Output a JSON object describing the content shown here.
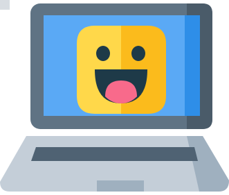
{
  "illustration": {
    "subject": "laptop-emoji-icon",
    "colors": {
      "bezel_dark": "#4a5b69",
      "bezel_mid": "#5f7384",
      "screen_blue": "#5aa9f5",
      "screen_blue_dark": "#2e8ee8",
      "base_light": "#c4ced8",
      "base_dark": "#9fb0bf",
      "keyboard_slot": "#4f6273",
      "trackpad": "#b9c5cf",
      "emoji_yellow_light": "#ffd84a",
      "emoji_yellow_dark": "#fbbb1c",
      "emoji_eye": "#1e3a48",
      "emoji_mouth": "#1e3a48",
      "emoji_tongue": "#f86a8b"
    }
  }
}
